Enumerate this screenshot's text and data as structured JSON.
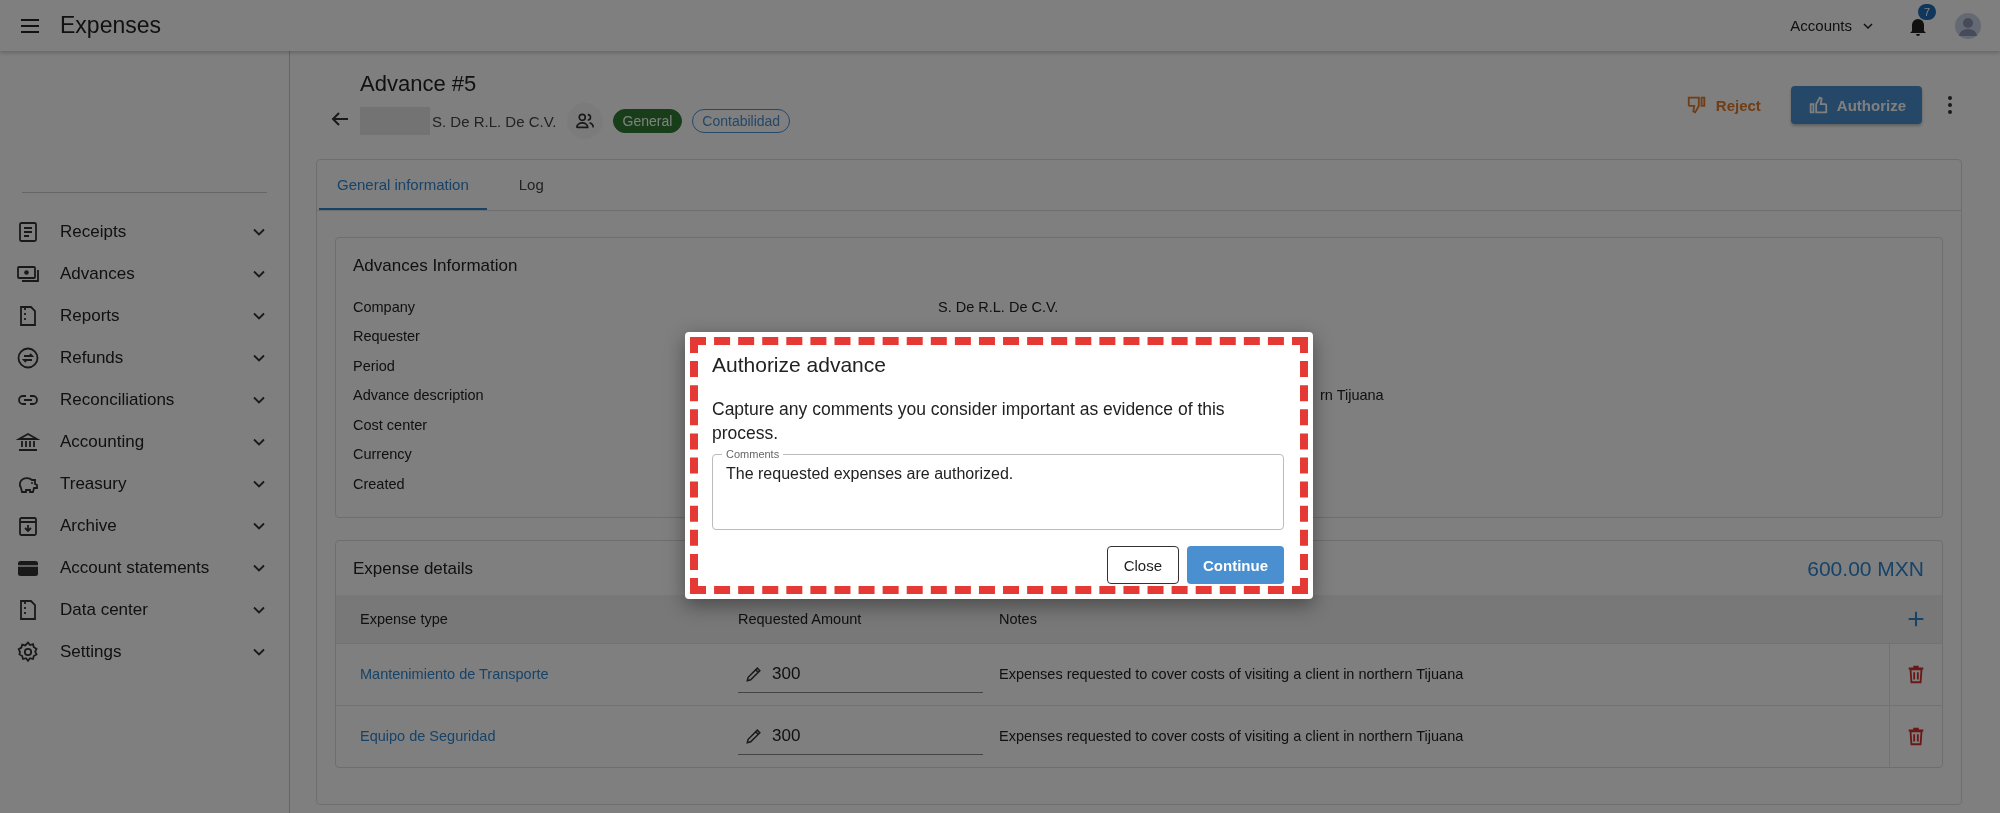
{
  "app_bar": {
    "title": "Expenses",
    "account_menu": "Accounts",
    "notification_count": "7"
  },
  "sidebar": {
    "items": [
      {
        "label": "Receipts"
      },
      {
        "label": "Advances"
      },
      {
        "label": "Reports"
      },
      {
        "label": "Refunds"
      },
      {
        "label": "Reconciliations"
      },
      {
        "label": "Accounting"
      },
      {
        "label": "Treasury"
      },
      {
        "label": "Archive"
      },
      {
        "label": "Account statements"
      },
      {
        "label": "Data center"
      },
      {
        "label": "Settings"
      }
    ]
  },
  "header": {
    "title": "Advance #5",
    "company": "S. De R.L. De C.V.",
    "tags": [
      {
        "label": "General",
        "kind": "filled"
      },
      {
        "label": "Contabilidad",
        "kind": "outlined"
      }
    ]
  },
  "actions": [
    {
      "label": "Reject",
      "kind": "text"
    },
    {
      "label": "Authorize",
      "kind": "primary"
    }
  ],
  "tabs": [
    {
      "label": "General information",
      "selected": true
    },
    {
      "label": "Log",
      "selected": false
    }
  ],
  "advances_information": {
    "title": "Advances Information",
    "fields": [
      {
        "label": "Company",
        "value": "S. De R.L. De C.V."
      },
      {
        "label": "Requester"
      },
      {
        "label": "Period"
      },
      {
        "label": "Advance description",
        "value": "rn Tijuana"
      },
      {
        "label": "Cost center"
      },
      {
        "label": "Currency"
      },
      {
        "label": "Created"
      }
    ]
  },
  "expense_details": {
    "title": "Expense details",
    "total": "600.00 MXN",
    "columns": [
      "Expense type",
      "Requested Amount",
      "Notes"
    ],
    "rows": [
      {
        "expense_type": "Mantenimiento de Transporte",
        "requested_amount": "300",
        "notes": "Expenses requested to cover costs of visiting a client in northern Tijuana"
      },
      {
        "expense_type": "Equipo de Seguridad",
        "requested_amount": "300",
        "notes": "Expenses requested to cover costs of visiting a client in northern Tijuana"
      }
    ]
  },
  "dialog": {
    "title": "Authorize advance",
    "message": "Capture any comments you consider important as evidence of this process.",
    "comments": {
      "label": "Comments",
      "value": "The requested expenses are authorized."
    },
    "buttons": [
      {
        "label": "Close",
        "kind": "outlined"
      },
      {
        "label": "Continue",
        "kind": "primary"
      }
    ]
  }
}
